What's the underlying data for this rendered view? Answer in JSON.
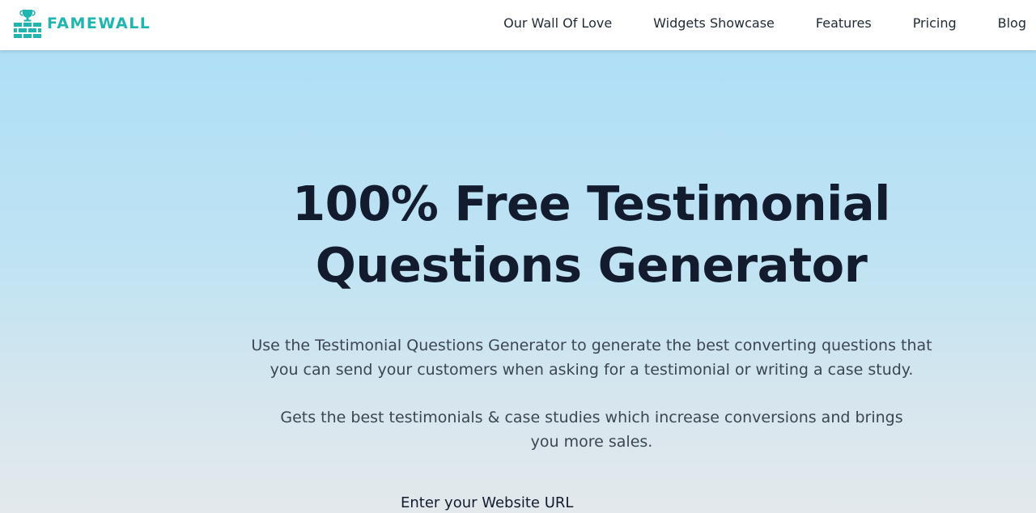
{
  "header": {
    "logo_text": "FAMEWALL",
    "nav": [
      {
        "label": "Our Wall Of Love"
      },
      {
        "label": "Widgets Showcase"
      },
      {
        "label": "Features"
      },
      {
        "label": "Pricing"
      },
      {
        "label": "Blog"
      }
    ]
  },
  "hero": {
    "title_line1": "100% Free Testimonial",
    "title_line2": "Questions Generator",
    "description_1": "Use the Testimonial Questions Generator to generate the best converting questions that you can send your customers when asking for a testimonial or writing a case study.",
    "description_2": "Gets the best testimonials & case studies which increase conversions and brings you more sales.",
    "url_label": "Enter your Website URL"
  },
  "colors": {
    "brand": "#1fb5b0",
    "heading": "#131c2e",
    "body_text": "#3c4652",
    "hero_top": "#afdff6",
    "hero_bottom": "#e3e9ec"
  },
  "icons": {
    "logo": "famewall-brick-wall-trophy-logo"
  }
}
